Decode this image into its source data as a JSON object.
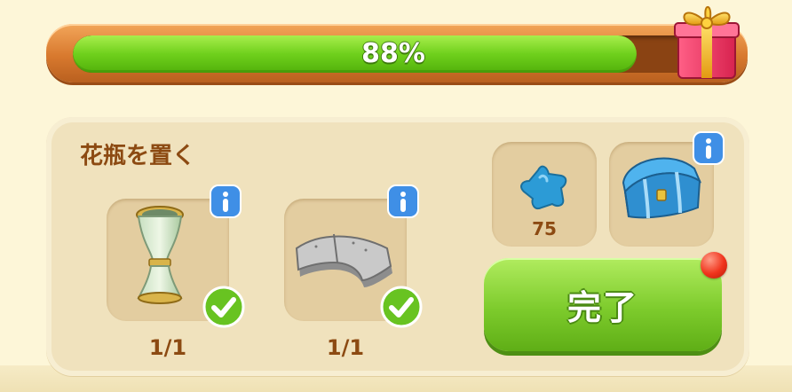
{
  "progress": {
    "percent": 88,
    "label": "88%"
  },
  "task": {
    "title": "花瓶を置く"
  },
  "requirements": [
    {
      "name": "vase",
      "icon": "vase-icon",
      "count": "1/1",
      "completed": true
    },
    {
      "name": "curved-stone-slab",
      "icon": "stone-slab-icon",
      "count": "1/1",
      "completed": true
    }
  ],
  "rewards": [
    {
      "icon": "blue-star-icon",
      "amount": "75"
    },
    {
      "icon": "blue-treasure-chest-icon"
    }
  ],
  "done_button": {
    "label": "完了"
  },
  "colors": {
    "progress_green": "#6fd01c",
    "frame_orange": "#d8792e",
    "panel": "#f0e2bd",
    "title_brown": "#8c4a12",
    "button_green": "#7dcb2c",
    "info_blue": "#3f8fe6",
    "notification_red": "#f0341c"
  }
}
